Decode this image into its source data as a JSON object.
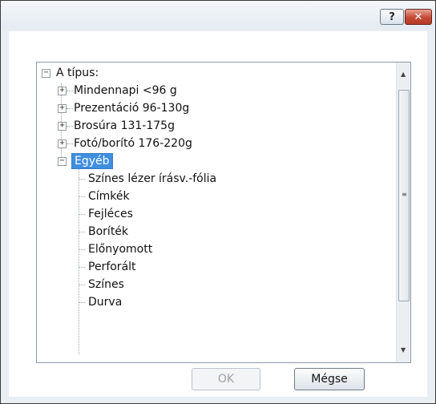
{
  "titlebar": {
    "help_label": "?",
    "close_label": "✕"
  },
  "tree": {
    "root_label": "A típus:",
    "items": [
      {
        "label": "Mindennapi <96 g"
      },
      {
        "label": "Prezentáció 96-130g"
      },
      {
        "label": "Brosúra 131-175g"
      },
      {
        "label": "Fotó/borító 176-220g"
      },
      {
        "label": "Egyéb"
      }
    ],
    "children": [
      {
        "label": "Színes lézer írásv.-fólia"
      },
      {
        "label": "Címkék"
      },
      {
        "label": "Fejléces"
      },
      {
        "label": "Boríték"
      },
      {
        "label": "Előnyomott"
      },
      {
        "label": "Perforált"
      },
      {
        "label": "Színes"
      },
      {
        "label": "Durva"
      }
    ]
  },
  "buttons": {
    "ok_label": "OK",
    "cancel_label": "Mégse"
  }
}
